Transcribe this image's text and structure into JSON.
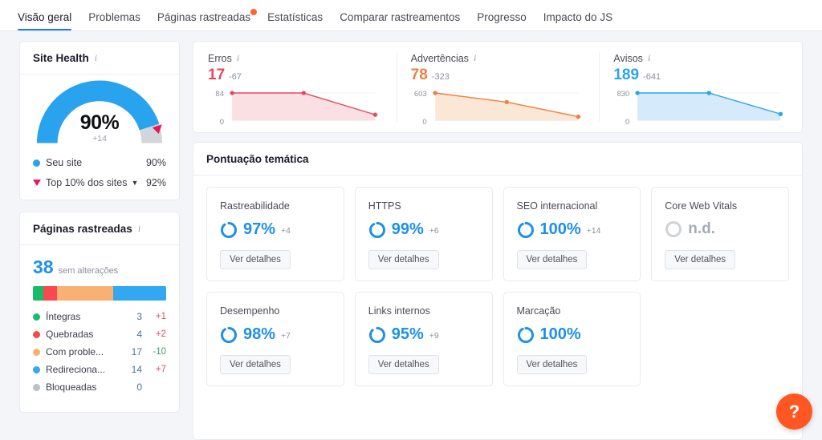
{
  "nav": {
    "tabs": [
      {
        "label": "Visão geral",
        "active": true,
        "badge": false
      },
      {
        "label": "Problemas",
        "active": false,
        "badge": false
      },
      {
        "label": "Páginas rastreadas",
        "active": false,
        "badge": true
      },
      {
        "label": "Estatísticas",
        "active": false,
        "badge": false
      },
      {
        "label": "Comparar rastreamentos",
        "active": false,
        "badge": false
      },
      {
        "label": "Progresso",
        "active": false,
        "badge": false
      },
      {
        "label": "Impacto do JS",
        "active": false,
        "badge": false
      }
    ]
  },
  "site_health": {
    "title": "Site Health",
    "info_icon": "info-icon",
    "gauge_percent": "90%",
    "gauge_delta": "+14",
    "gauge_value": 90,
    "benchmark_value": 92,
    "legend": [
      {
        "label": "Seu site",
        "value": "90%",
        "marker": "dot",
        "color": "#2aa3ee"
      },
      {
        "label": "Top 10% dos sites",
        "value": "92%",
        "marker": "triangle",
        "color": "#e8175d",
        "chevron": "chevron-down-icon"
      }
    ]
  },
  "crawled_pages": {
    "title": "Páginas rastreadas",
    "info_icon": "info-icon",
    "total": "38",
    "subtitle": "sem alterações",
    "stack": [
      {
        "color": "#18bd6c",
        "pct": 8
      },
      {
        "color": "#f9484f",
        "pct": 10
      },
      {
        "color": "#f8b173",
        "pct": 42
      },
      {
        "color": "#31a8f0",
        "pct": 40
      }
    ],
    "rows": [
      {
        "label": "Íntegras",
        "color": "#18bd6c",
        "count": "3",
        "delta": "+1",
        "dir": "up"
      },
      {
        "label": "Quebradas",
        "color": "#f9484f",
        "count": "4",
        "delta": "+2",
        "dir": "up"
      },
      {
        "label": "Com proble...",
        "color": "#f8b173",
        "count": "17",
        "delta": "-10",
        "dir": "down"
      },
      {
        "label": "Redireciona...",
        "color": "#31a8f0",
        "count": "14",
        "delta": "+7",
        "dir": "up"
      },
      {
        "label": "Bloqueadas",
        "color": "#bcc0c7",
        "count": "0",
        "delta": "",
        "dir": ""
      }
    ]
  },
  "metrics": [
    {
      "name": "Erros",
      "info_icon": "info-icon",
      "value": "17",
      "delta": "-67",
      "color": "#e8485f",
      "fill": "#fadfe3",
      "axis_top": "84",
      "axis_bottom": "0"
    },
    {
      "name": "Advertências",
      "info_icon": "info-icon",
      "value": "78",
      "delta": "-323",
      "color": "#f07f40",
      "fill": "#fbe7d5",
      "axis_top": "603",
      "axis_bottom": "0"
    },
    {
      "name": "Avisos",
      "info_icon": "info-icon",
      "value": "189",
      "delta": "-641",
      "color": "#2aa3ee",
      "fill": "#d5eafa",
      "axis_top": "830",
      "axis_bottom": "0"
    }
  ],
  "thematic": {
    "title": "Pontuação temática",
    "detail_button_label": "Ver detalhes",
    "cards": [
      {
        "name": "Rastreabilidade",
        "value": "97%",
        "delta": "+4",
        "ring_pct": 97,
        "na": false
      },
      {
        "name": "HTTPS",
        "value": "99%",
        "delta": "+6",
        "ring_pct": 99,
        "na": false
      },
      {
        "name": "SEO internacional",
        "value": "100%",
        "delta": "+14",
        "ring_pct": 100,
        "na": false
      },
      {
        "name": "Core Web Vitals",
        "value": "n.d.",
        "delta": "",
        "ring_pct": 0,
        "na": true
      },
      {
        "name": "Desempenho",
        "value": "98%",
        "delta": "+7",
        "ring_pct": 98,
        "na": false
      },
      {
        "name": "Links internos",
        "value": "95%",
        "delta": "+9",
        "ring_pct": 95,
        "na": false
      },
      {
        "name": "Marcação",
        "value": "100%",
        "delta": "",
        "ring_pct": 100,
        "na": false
      }
    ]
  },
  "help": {
    "label": "?"
  },
  "chart_data": [
    {
      "type": "area",
      "title": "Erros",
      "x": [
        0,
        1,
        2
      ],
      "values": [
        84,
        84,
        17
      ],
      "ylim": [
        0,
        84
      ],
      "ylabel": "",
      "xlabel": "",
      "color": "#e8485f",
      "legend": "none",
      "grid": false
    },
    {
      "type": "area",
      "title": "Advertências",
      "x": [
        0,
        1,
        2
      ],
      "values": [
        603,
        401,
        78
      ],
      "ylim": [
        0,
        603
      ],
      "ylabel": "",
      "xlabel": "",
      "color": "#f07f40",
      "legend": "none",
      "grid": false
    },
    {
      "type": "area",
      "title": "Avisos",
      "x": [
        0,
        1,
        2
      ],
      "values": [
        830,
        830,
        189
      ],
      "ylim": [
        0,
        830
      ],
      "ylabel": "",
      "xlabel": "",
      "color": "#2aa3ee",
      "legend": "none",
      "grid": false
    },
    {
      "type": "pie",
      "title": "Site Health",
      "categories": [
        "Seu site",
        "Top 10% dos sites"
      ],
      "values": [
        90,
        92
      ],
      "legend": "bottom"
    },
    {
      "type": "bar",
      "title": "Páginas rastreadas",
      "categories": [
        "Íntegras",
        "Quebradas",
        "Com problemas",
        "Redirecionadas",
        "Bloqueadas"
      ],
      "values": [
        3,
        4,
        17,
        14,
        0
      ],
      "total": 38,
      "legend": "bottom"
    }
  ]
}
